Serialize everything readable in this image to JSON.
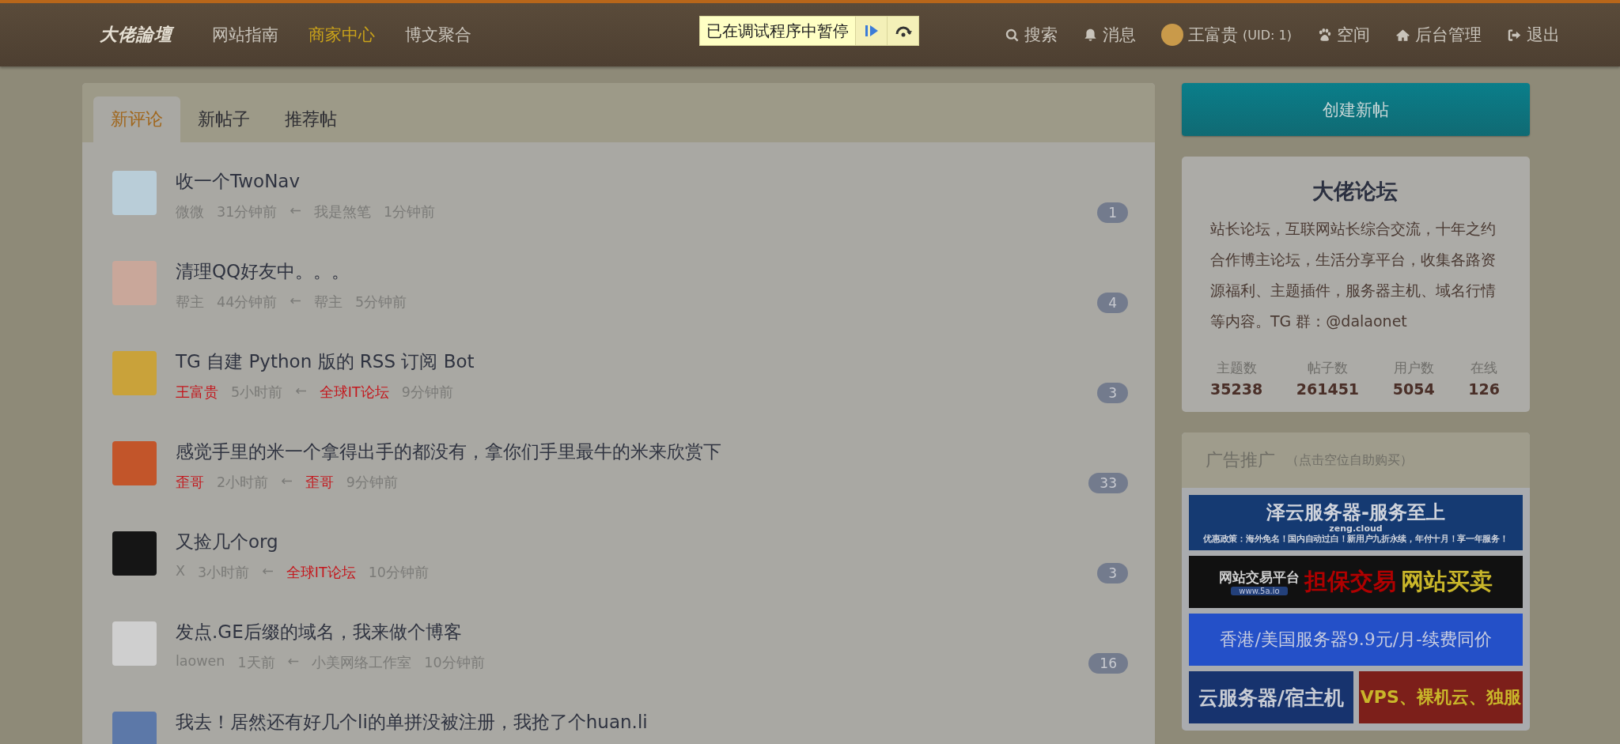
{
  "logo": "大佬論壇",
  "nav": {
    "links": [
      {
        "label": "网站指南",
        "selected": false
      },
      {
        "label": "商家中心",
        "selected": true
      },
      {
        "label": "博文聚合",
        "selected": false
      }
    ],
    "actions": [
      {
        "kind": "search",
        "label": "搜索"
      },
      {
        "kind": "bell",
        "label": "消息"
      },
      {
        "kind": "user",
        "label": "王富贵",
        "suffix": "(UID: 1)"
      },
      {
        "kind": "paw",
        "label": "空间"
      },
      {
        "kind": "home",
        "label": "后台管理"
      },
      {
        "kind": "exit",
        "label": "退出"
      }
    ]
  },
  "debugger": {
    "message": "已在调试程序中暂停"
  },
  "tabs": [
    {
      "label": "新评论",
      "selected": true
    },
    {
      "label": "新帖子",
      "selected": false
    },
    {
      "label": "推荐帖",
      "selected": false
    }
  ],
  "threads": [
    {
      "title": "收一个TwoNav",
      "author": {
        "name": "微微",
        "color": "#7b7b78"
      },
      "posted": "31分钟前",
      "arrow": "←",
      "reply_author": {
        "name": "我是煞笔",
        "color": "#7b7b78"
      },
      "replied": "1分钟前",
      "count": "1"
    },
    {
      "title": "清理QQ好友中。。。",
      "author": {
        "name": "帮主",
        "color": "#7b7b78"
      },
      "posted": "44分钟前",
      "arrow": "←",
      "reply_author": {
        "name": "帮主",
        "color": "#7b7b78"
      },
      "replied": "5分钟前",
      "count": "4"
    },
    {
      "title": "TG 自建 Python 版的 RSS 订阅 Bot",
      "author": {
        "name": "王富贵",
        "color": "#c4161c"
      },
      "posted": "5小时前",
      "arrow": "←",
      "reply_author": {
        "name": "全球IT论坛",
        "color": "#c4161c"
      },
      "replied": "9分钟前",
      "count": "3"
    },
    {
      "title": "感觉手里的米一个拿得出手的都没有，拿你们手里最牛的米来欣赏下",
      "author": {
        "name": "歪哥",
        "color": "#c4161c"
      },
      "posted": "2小时前",
      "arrow": "←",
      "reply_author": {
        "name": "歪哥",
        "color": "#c4161c"
      },
      "replied": "9分钟前",
      "count": "33"
    },
    {
      "title": "又捡几个org",
      "author": {
        "name": "X",
        "color": "#7b7b78"
      },
      "posted": "3小时前",
      "arrow": "←",
      "reply_author": {
        "name": "全球IT论坛",
        "color": "#c4161c"
      },
      "replied": "10分钟前",
      "count": "3"
    },
    {
      "title": "发点.GE后缀的域名，我来做个博客",
      "author": {
        "name": "laowen",
        "color": "#7b7b78"
      },
      "posted": "1天前",
      "arrow": "←",
      "reply_author": {
        "name": "小美网络工作室",
        "color": "#7b7b78"
      },
      "replied": "10分钟前",
      "count": "16"
    },
    {
      "title": "我去！居然还有好几个li的单拼没被注册，我抢了个huan.li"
    }
  ],
  "create_button": "创建新帖",
  "about": {
    "title": "大佬论坛",
    "description": "站长论坛，互联网站长综合交流，十年之约合作博主论坛，生活分享平台，收集各路资源福利、主题插件，服务器主机、域名行情等内容。TG 群：@dalaonet",
    "stats": [
      {
        "label": "主题数",
        "value": "35238"
      },
      {
        "label": "帖子数",
        "value": "261451"
      },
      {
        "label": "用户数",
        "value": "5054"
      },
      {
        "label": "在线",
        "value": "126"
      }
    ]
  },
  "ads": {
    "title": "广告推广",
    "note": "（点击空位自助购买）",
    "banners": [
      {
        "kind": "cloud",
        "texts": [
          "泽云服务器-服务至上",
          "zeng.cloud",
          "优惠政策：海外免名！国内自动过白！新用户九折永续，年付十月！享一年服务！"
        ]
      },
      {
        "kind": "trade",
        "texts": [
          "网站交易平台",
          "www.5a.io",
          "担保交易",
          "网站买卖"
        ]
      },
      {
        "kind": "plain",
        "texts": [
          "香港/美国服务器9.9元/月-续费同价"
        ]
      },
      {
        "kind": "navy",
        "texts": [
          "云服务器/宿主机"
        ]
      },
      {
        "kind": "red",
        "texts": [
          "VPS、裸机云、独服"
        ]
      }
    ]
  }
}
